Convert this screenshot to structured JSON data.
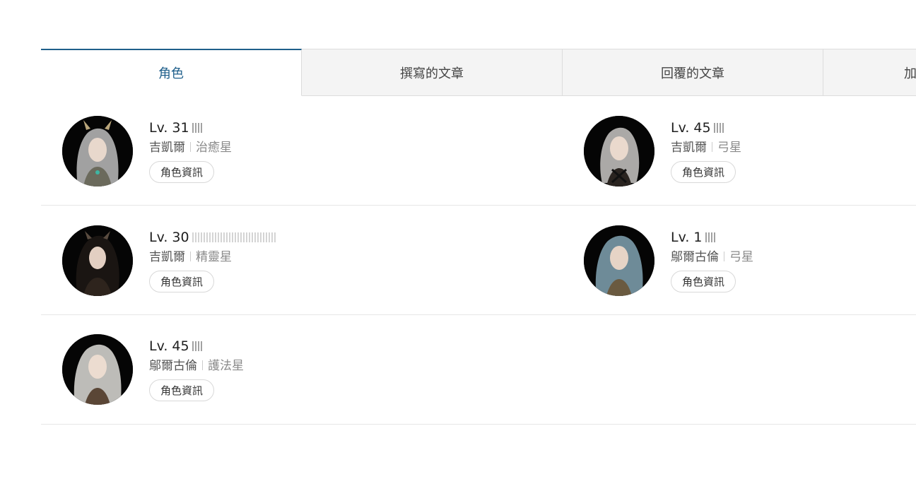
{
  "tabs": [
    {
      "label": "角色"
    },
    {
      "label": "撰寫的文章"
    },
    {
      "label": "回覆的文章"
    },
    {
      "label": "加"
    }
  ],
  "characters": [
    {
      "level": "Lv. 31",
      "server": "吉凱爾",
      "class": "治癒星",
      "button": "角色資訊",
      "hair": "#bdbdbd"
    },
    {
      "level": "Lv. 45",
      "server": "吉凱爾",
      "class": "弓星",
      "button": "角色資訊",
      "hair": "#c9c7c4"
    },
    {
      "level": "Lv. 30",
      "server": "吉凱爾",
      "class": "精靈星",
      "button": "角色資訊",
      "hair": "#1a1512"
    },
    {
      "level": "Lv. 1",
      "server": "鄔爾古倫",
      "class": "弓星",
      "button": "角色資訊",
      "hair": "#7a9aa8"
    },
    {
      "level": "Lv. 45",
      "server": "鄔爾古倫",
      "class": "護法星",
      "button": "角色資訊",
      "hair": "#d2d0cc"
    }
  ],
  "colors": {
    "accent": "#1f5f8b",
    "tab_bg": "#f4f4f4",
    "avatar_bg": "#050505"
  }
}
